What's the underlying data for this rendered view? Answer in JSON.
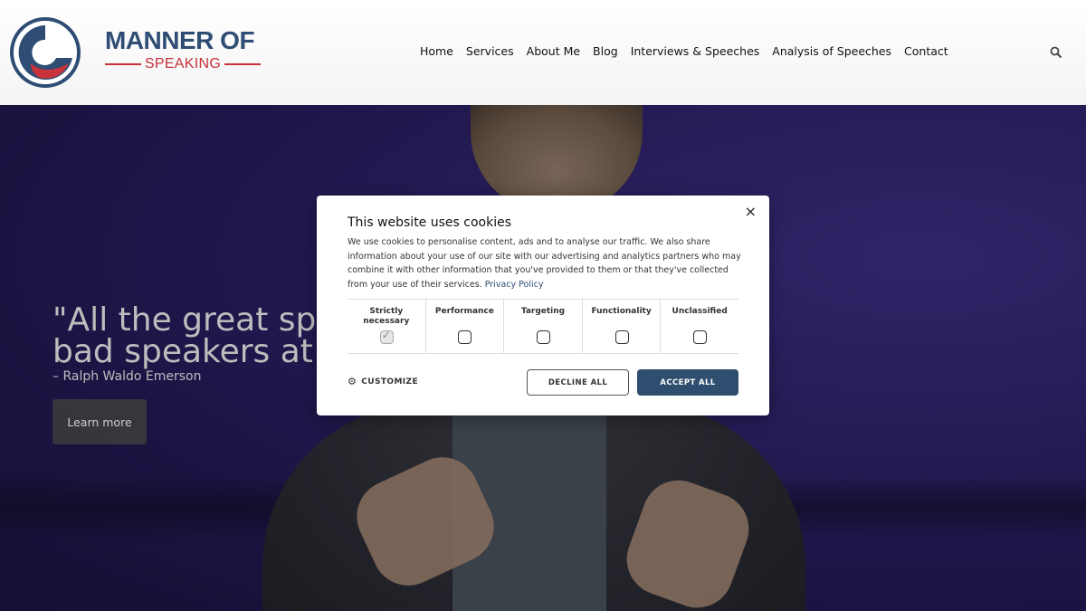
{
  "header": {
    "brand_top": "MANNER OF",
    "brand_bottom": "SPEAKING",
    "nav": [
      "Home",
      "Services",
      "About Me",
      "Blog",
      "Interviews & Speeches",
      "Analysis of Speeches",
      "Contact"
    ]
  },
  "hero": {
    "quote_line1": "\"All the great speak",
    "quote_line2": "bad speakers at fir",
    "author": "– Ralph Waldo Emerson",
    "learn_more": "Learn more"
  },
  "cookie": {
    "title": "This website uses cookies",
    "body": "We use cookies to personalise content, ads and to analyse our traffic. We also share information about your use of our site with our advertising and analytics partners who may combine it with other information that you've provided to them or that they've collected from your use of their services.",
    "privacy_link": "Privacy Policy",
    "categories": [
      {
        "label": "Strictly necessary",
        "checked": true
      },
      {
        "label": "Performance",
        "checked": false
      },
      {
        "label": "Targeting",
        "checked": false
      },
      {
        "label": "Functionality",
        "checked": false
      },
      {
        "label": "Unclassified",
        "checked": false
      }
    ],
    "customize": "CUSTOMIZE",
    "decline": "DECLINE ALL",
    "accept": "ACCEPT ALL",
    "close": "×"
  },
  "colors": {
    "brand_blue": "#2f4d74",
    "brand_red": "#c8323a",
    "accept_bg": "#2f4d6f"
  }
}
